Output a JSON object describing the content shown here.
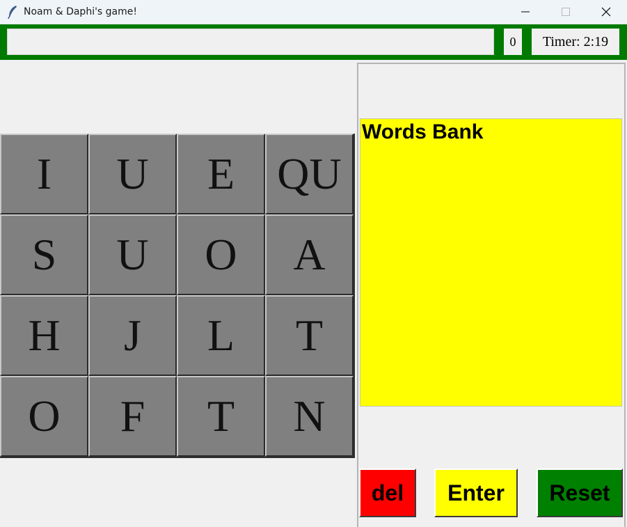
{
  "window": {
    "title": "Noam & Daphi's game!",
    "icon": "feather-icon"
  },
  "topbar": {
    "word_input_value": "",
    "score": "0",
    "timer": "Timer: 2:19",
    "background_color": "#007a00"
  },
  "board": {
    "tiles": [
      "I",
      "U",
      "E",
      "QU",
      "S",
      "U",
      "O",
      "A",
      "H",
      "J",
      "L",
      "T",
      "O",
      "F",
      "T",
      "N"
    ],
    "tile_color": "#808080"
  },
  "words_bank": {
    "title": "Words Bank",
    "words": [],
    "background_color": "#ffff00"
  },
  "buttons": {
    "del": {
      "label": "del",
      "color": "#ff0000"
    },
    "enter": {
      "label": "Enter",
      "color": "#ffff00"
    },
    "reset": {
      "label": "Reset",
      "color": "#008000"
    }
  }
}
